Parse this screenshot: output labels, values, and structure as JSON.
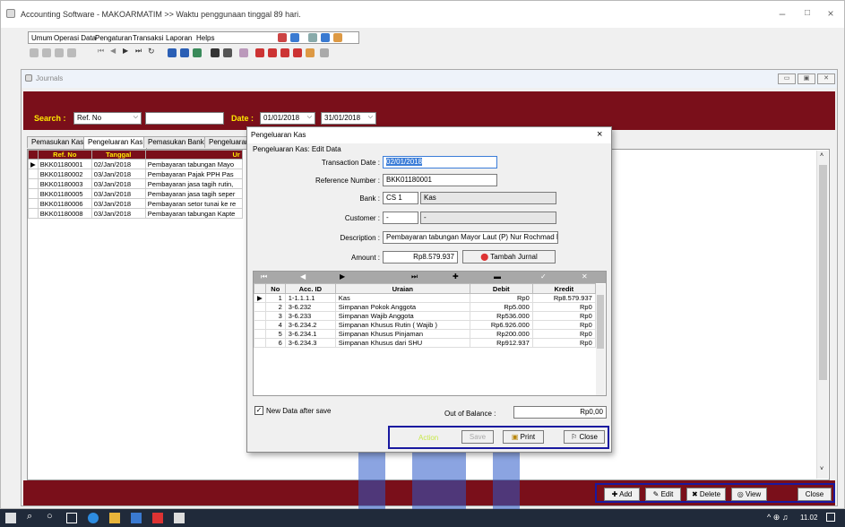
{
  "app": {
    "title": "Accounting Software - MAKOARMATIM >> Waktu penggunaan tinggal 89 hari.",
    "menu": [
      "Umum",
      "Operasi Data",
      "Pengaturan",
      "Transaksi",
      "Laporan",
      "Helps"
    ]
  },
  "journals": {
    "title": "Journals",
    "search_label": "Search :",
    "search_field": "Ref. No",
    "search_value": "",
    "date_label": "Date :",
    "date_from": "01/01/2018",
    "date_to": "31/01/2018",
    "tabs": [
      "Pemasukan Kas",
      "Pengeluaran Kas",
      "Pemasukan Bank",
      "Pengeluaran B"
    ],
    "active_tab": 1,
    "columns": [
      "Ref. No",
      "Tanggal",
      "Ur"
    ],
    "rows": [
      [
        "BKK01180001",
        "02/Jan/2018",
        "Pembayaran tabungan Mayo"
      ],
      [
        "BKK01180002",
        "03/Jan/2018",
        "Pembayaran Pajak PPH Pas"
      ],
      [
        "BKK01180003",
        "03/Jan/2018",
        "Pembayaran jasa tagih rutin,"
      ],
      [
        "BKK01180005",
        "03/Jan/2018",
        "Pembayaran jasa tagih seper"
      ],
      [
        "BKK01180006",
        "03/Jan/2018",
        "Pembayaran setor tunai ke re"
      ],
      [
        "BKK01180008",
        "03/Jan/2018",
        "Pembayaran tabungan Kapte"
      ]
    ],
    "buttons": {
      "add": "Add",
      "edit": "Edit",
      "delete": "Delete",
      "view": "View",
      "close": "Close"
    }
  },
  "dialog": {
    "title": "Pengeluaran Kas",
    "subtitle": "Pengeluaran Kas: Edit Data",
    "transaction_date_label": "Transaction Date :",
    "transaction_date": "02/01/2018",
    "ref_label": "Reference Number :",
    "ref_value": "BKK01180001",
    "bank_label": "Bank :",
    "bank_code": "CS 1",
    "bank_name": "Kas",
    "customer_label": "Customer :",
    "customer_code": "-",
    "customer_name": "-",
    "description_label": "Description :",
    "description": "Pembayaran tabungan Mayor Laut (P) Nur Rochmad Nip '",
    "amount_label": "Amount :",
    "amount": "Rp8.579.937",
    "tambah_label": "Tambah Jurnal",
    "journal": {
      "columns": [
        "No",
        "Acc. ID",
        "Uraian",
        "Debit",
        "Kredit"
      ],
      "rows": [
        [
          "1",
          "1-1.1.1.1",
          "Kas",
          "Rp0",
          "Rp8.579.937"
        ],
        [
          "2",
          "3-6.232",
          "Simpanan Pokok Anggota",
          "Rp5.000",
          "Rp0"
        ],
        [
          "3",
          "3-6.233",
          "Simpanan Wajib Anggota",
          "Rp536.000",
          "Rp0"
        ],
        [
          "4",
          "3-6.234.2",
          "Simpanan Khusus Rutin ( Wajib )",
          "Rp6.926.000",
          "Rp0"
        ],
        [
          "5",
          "3-6.234.1",
          "Simpanan Khusus Pinjaman",
          "Rp200.000",
          "Rp0"
        ],
        [
          "6",
          "3-6.234.3",
          "Simpanan Khusus dari SHU",
          "Rp912.937",
          "Rp0"
        ]
      ]
    },
    "new_data_label": "New Data after save",
    "new_data_checked": true,
    "balance_label": "Out of Balance :",
    "balance_value": "Rp0,00",
    "action_label": "Action",
    "save_label": "Save",
    "print_label": "Print",
    "close_label": "Close"
  },
  "taskbar": {
    "clock": "11.02"
  }
}
